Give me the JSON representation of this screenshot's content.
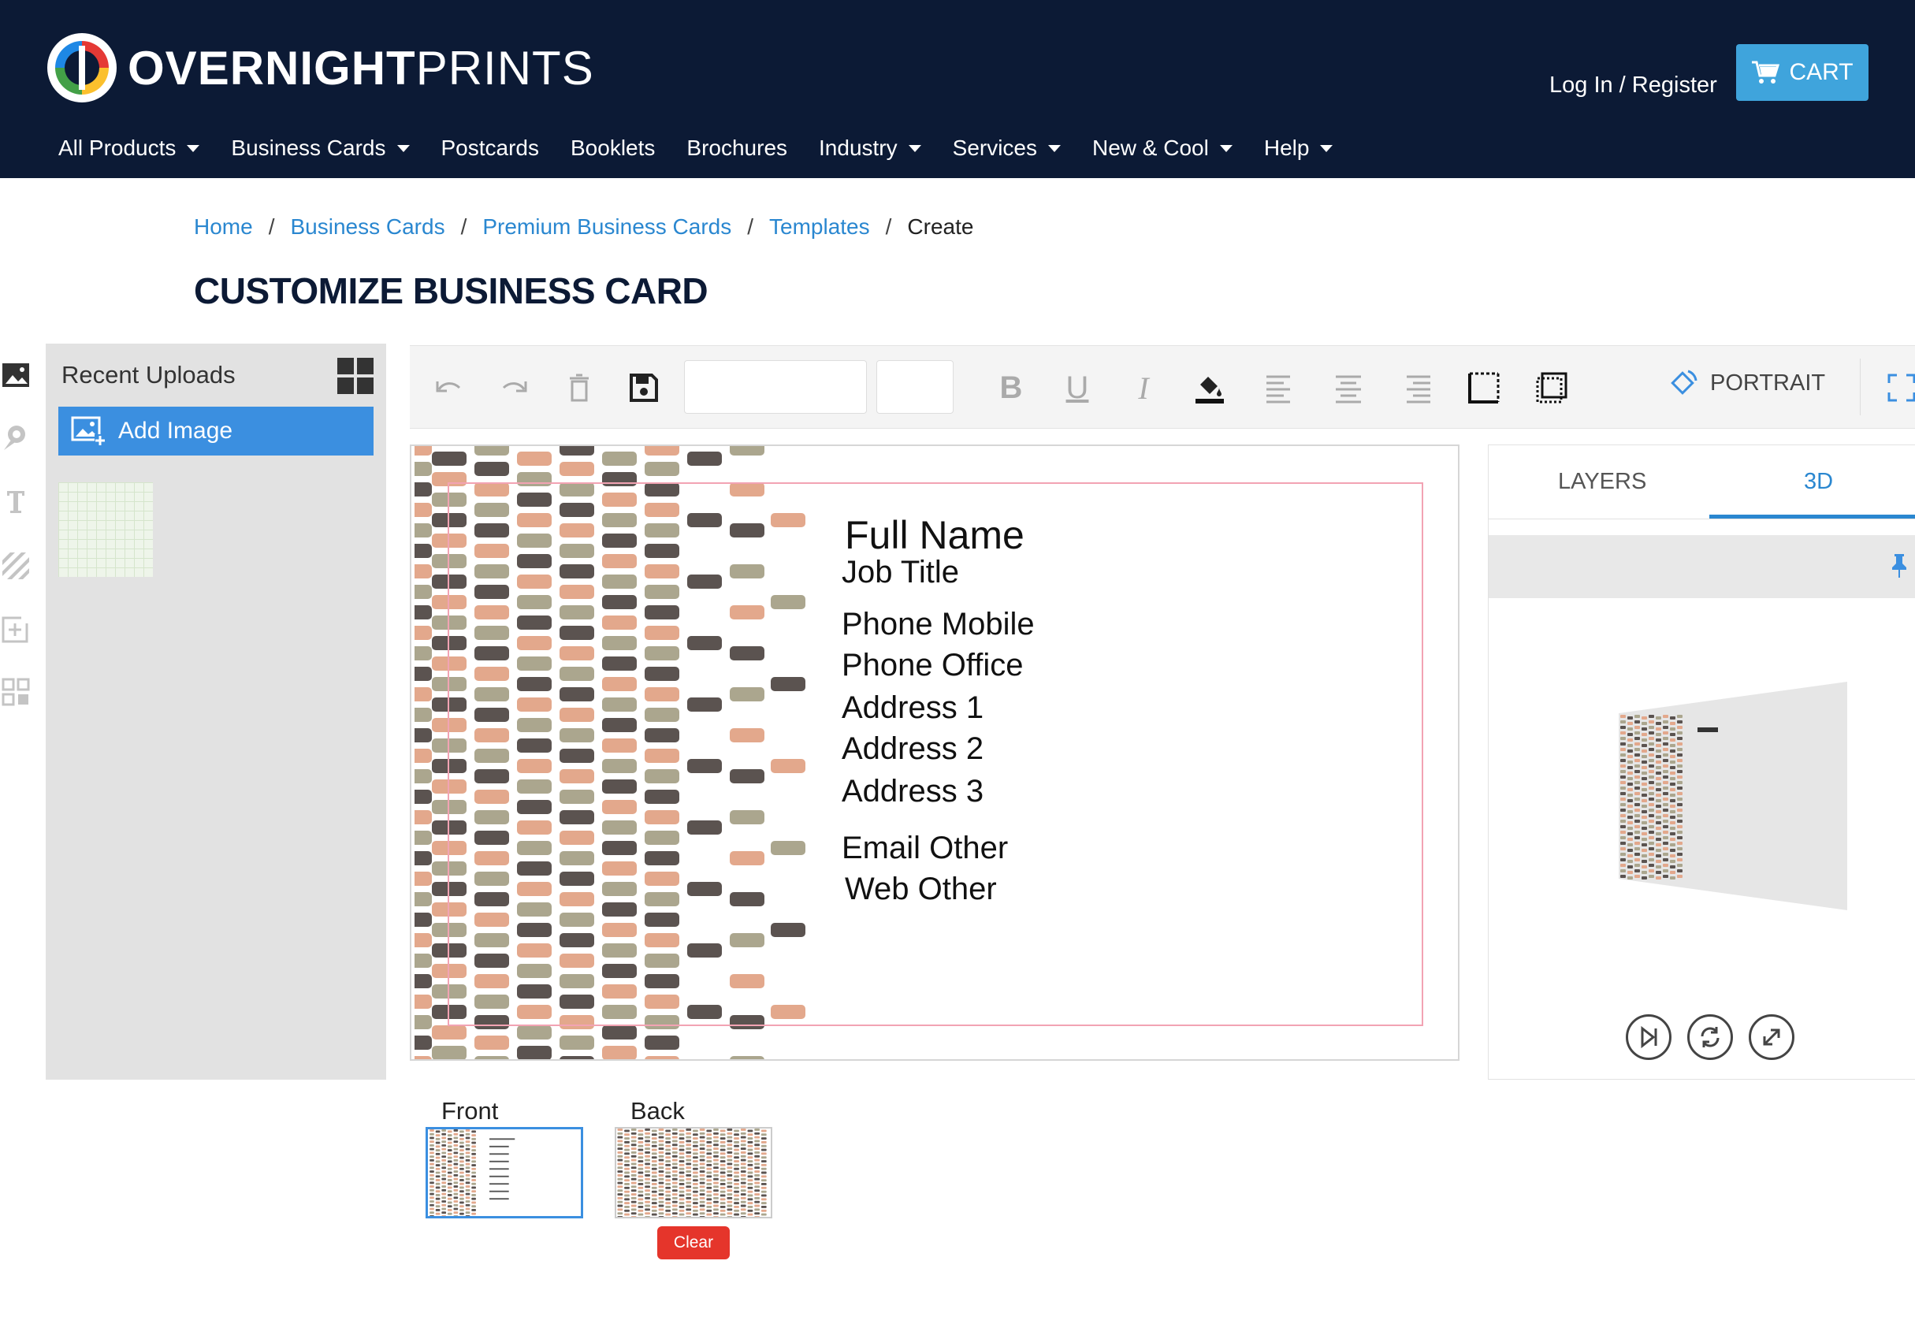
{
  "header": {
    "logo": {
      "bold": "OVERNIGHT",
      "light": "PRINTS"
    },
    "login_label": "Log In / Register",
    "cart_label": "CART",
    "nav": [
      {
        "label": "All Products",
        "dropdown": true
      },
      {
        "label": "Business Cards",
        "dropdown": true
      },
      {
        "label": "Postcards",
        "dropdown": false
      },
      {
        "label": "Booklets",
        "dropdown": false
      },
      {
        "label": "Brochures",
        "dropdown": false
      },
      {
        "label": "Industry",
        "dropdown": true
      },
      {
        "label": "Services",
        "dropdown": true
      },
      {
        "label": "New & Cool",
        "dropdown": true
      },
      {
        "label": "Help",
        "dropdown": true
      }
    ]
  },
  "breadcrumb": {
    "items": [
      "Home",
      "Business Cards",
      "Premium Business Cards",
      "Templates"
    ],
    "separator": "/",
    "current": "Create"
  },
  "page_title": "CUSTOMIZE BUSINESS CARD",
  "uploads": {
    "title": "Recent Uploads",
    "add_image_label": "Add Image"
  },
  "toolbar": {
    "font_value": "",
    "size_value": "",
    "bold": "B",
    "underline": "U",
    "italic": "I",
    "orientation_label": "PORTRAIT"
  },
  "card": {
    "name": "Full Name",
    "job_title": "Job Title",
    "phone_mobile": "Phone Mobile",
    "phone_office": "Phone Office",
    "address1": "Address 1",
    "address2": "Address 2",
    "address3": "Address 3",
    "email": "Email Other",
    "web": "Web Other"
  },
  "right_panel": {
    "tabs": [
      {
        "label": "LAYERS",
        "active": false
      },
      {
        "label": "3D",
        "active": true
      }
    ]
  },
  "sides": {
    "front_label": "Front",
    "back_label": "Back",
    "clear_label": "Clear"
  },
  "colors": {
    "header_bg": "#0c1a35",
    "cart_bg": "#3fa4dc",
    "link": "#2a87d0",
    "add_image_bg": "#3b8fe0",
    "clear_bg": "#e5352b",
    "pattern": [
      "#e3a88c",
      "#aba68e",
      "#5b5350"
    ]
  }
}
